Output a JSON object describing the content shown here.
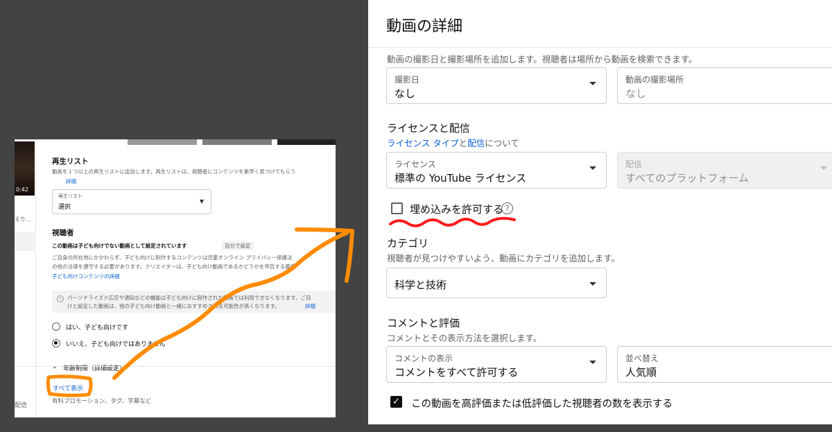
{
  "left": {
    "duration": "0:42",
    "sidebar_text_1": "えり…",
    "sidebar_text_2": "配信",
    "playlist": {
      "heading": "再生リスト",
      "desc": "動画を１つ以上の再生リストに追加します。再生リストは、視聴者にコンテンツを素早く見つけてもらう",
      "link": "詳細",
      "box_caption": "再生リスト",
      "box_value": "選択"
    },
    "audience": {
      "heading": "視聴者",
      "status": "この動画は子ども向けでない動画として設定されています",
      "badge": "自分で設定",
      "desc_1": "ご自身の所在地にかかわらず、子ども向けに制作するコンテンツは児童オンライン プライバシー保護法",
      "desc_2": "の他の法律を遵守する必要があります。クリエイターは、子ども向け動画であるかどうかを申告する義務",
      "link": "子ども向けコンテンツの詳細",
      "info_1": "パーソナライズド広告や通知などの機能は子ども向けに制作された動画では利用できなくなります。ご自",
      "info_2": "けと設定した動画は、他の子ども向け動画と一緒におすすめされる可能性が高くなります。",
      "info_link": "詳細",
      "opt_yes": "はい、子ども向けです",
      "opt_no": "いいえ、子ども向けではありません"
    },
    "age_restriction": "年齢制限（詳細設定）",
    "show_all": "すべて表示",
    "more_desc": "有料プロモーション、タグ、字幕など"
  },
  "right": {
    "title": "動画の詳細",
    "location_desc": "動画の撮影日と撮影場所を追加します。視聴者は場所から動画を検索できます。",
    "date_caption": "撮影日",
    "date_value": "なし",
    "place_caption": "動画の撮影場所",
    "place_value": "なし",
    "license_heading": "ライセンスと配信",
    "license_link_1": "ライセンス タイプ",
    "license_and": "と",
    "license_link_2": "配信",
    "license_suffix": "について",
    "license_caption": "ライセンス",
    "license_value": "標準の YouTube ライセンス",
    "dist_caption": "配信",
    "dist_value": "すべてのプラットフォーム",
    "embed_label": "埋め込みを許可する",
    "help_glyph": "?",
    "category_heading": "カテゴリ",
    "category_desc": "視聴者が見つけやすいよう、動画にカテゴリを追加します。",
    "category_value": "科学と技術",
    "comments_heading": "コメントと評価",
    "comments_desc": "コメントとその表示方法を選択します。",
    "comment_caption": "コメントの表示",
    "comment_value": "コメントをすべて許可する",
    "sort_caption": "並べ替え",
    "sort_value": "人気順",
    "rating_label": "この動画を高評価または低評価した視聴者の数を表示する",
    "check_glyph": "✓"
  },
  "colors": {
    "annotation_orange": "#ff8c00",
    "annotation_red": "#ff1a1a",
    "link_blue": "#065fd4",
    "background": "#434343"
  }
}
